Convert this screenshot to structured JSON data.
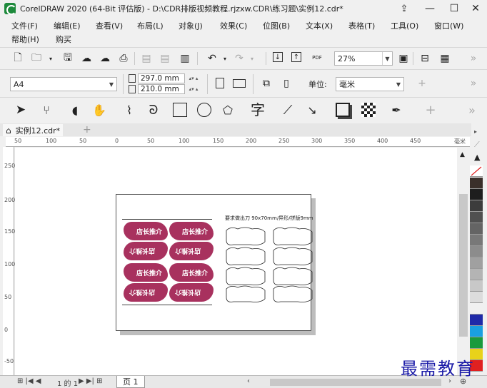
{
  "window": {
    "title": "CorelDRAW 2020 (64-Bit 评估版) - D:\\CDR排版视频教程.rjzxw.CDR\\练习题\\实例12.cdr*",
    "minimize": "—",
    "maximize": "☐",
    "close": "✕"
  },
  "menu": {
    "row1": [
      "文件(F)",
      "编辑(E)",
      "查看(V)",
      "布局(L)",
      "对象(J)",
      "效果(C)",
      "位图(B)",
      "文本(X)",
      "表格(T)",
      "工具(O)",
      "窗口(W)"
    ],
    "row2": [
      "帮助(H)",
      "购买"
    ]
  },
  "standard_toolbar": {
    "zoom_value": "27%",
    "pdf_label": "PDF"
  },
  "property_bar": {
    "paper_size": "A4",
    "width": "297.0 mm",
    "height": "210.0 mm",
    "units_label": "单位:",
    "units_value": "毫米"
  },
  "document_tab": {
    "label": "实例12.cdr*",
    "add": "+"
  },
  "ruler": {
    "unit": "毫米",
    "h_ticks": [
      "50",
      "100",
      "50",
      "0",
      "50",
      "100",
      "150",
      "200",
      "250",
      "300",
      "350",
      "400",
      "450"
    ],
    "v_ticks": [
      "250",
      "200",
      "150",
      "100",
      "50",
      "0",
      "-50"
    ]
  },
  "artwork": {
    "note": "要求做出刀 90x70mm/异形/拼版9mm",
    "sticker_top": "店长推介",
    "sticker_bottom": "店长推介"
  },
  "bottom": {
    "pager": "1 的 1",
    "page_tab": "页 1"
  },
  "watermark": "最需教育",
  "palette_colors": [
    "#3a2f2a",
    "#1e1e1e",
    "#3c3c3c",
    "#505050",
    "#646464",
    "#787878",
    "#8c8c8c",
    "#a0a0a0",
    "#b4b4b4",
    "#c8c8c8",
    "#dcdcdc",
    "#f0f0f0",
    "#1f2aa8",
    "#1aa0e0",
    "#1a9a3c",
    "#e8d21a",
    "#e02020"
  ]
}
